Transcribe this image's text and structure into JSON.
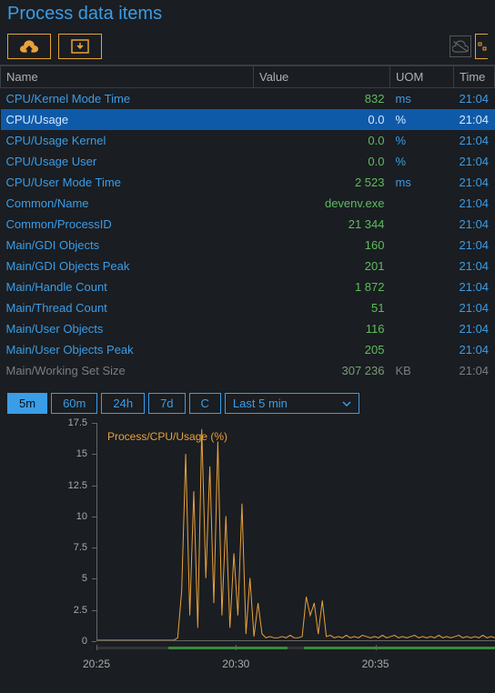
{
  "title": "Process data items",
  "columns": {
    "name": "Name",
    "value": "Value",
    "uom": "UOM",
    "time": "Time"
  },
  "rows": [
    {
      "name": "CPU/Kernel Mode Time",
      "value": "832",
      "uom": "ms",
      "time": "21:04",
      "sel": false
    },
    {
      "name": "CPU/Usage",
      "value": "0.0",
      "uom": "%",
      "time": "21:04",
      "sel": true
    },
    {
      "name": "CPU/Usage Kernel",
      "value": "0.0",
      "uom": "%",
      "time": "21:04",
      "sel": false
    },
    {
      "name": "CPU/Usage User",
      "value": "0.0",
      "uom": "%",
      "time": "21:04",
      "sel": false
    },
    {
      "name": "CPU/User Mode Time",
      "value": "2 523",
      "uom": "ms",
      "time": "21:04",
      "sel": false
    },
    {
      "name": "Common/Name",
      "value": "devenv.exe",
      "uom": "",
      "time": "21:04",
      "sel": false
    },
    {
      "name": "Common/ProcessID",
      "value": "21 344",
      "uom": "",
      "time": "21:04",
      "sel": false
    },
    {
      "name": "Main/GDI Objects",
      "value": "160",
      "uom": "",
      "time": "21:04",
      "sel": false
    },
    {
      "name": "Main/GDI Objects Peak",
      "value": "201",
      "uom": "",
      "time": "21:04",
      "sel": false
    },
    {
      "name": "Main/Handle Count",
      "value": "1 872",
      "uom": "",
      "time": "21:04",
      "sel": false
    },
    {
      "name": "Main/Thread Count",
      "value": "51",
      "uom": "",
      "time": "21:04",
      "sel": false
    },
    {
      "name": "Main/User Objects",
      "value": "116",
      "uom": "",
      "time": "21:04",
      "sel": false
    },
    {
      "name": "Main/User Objects Peak",
      "value": "205",
      "uom": "",
      "time": "21:04",
      "sel": false
    },
    {
      "name": "Main/Working Set Size",
      "value": "307 236",
      "uom": "KB",
      "time": "21:04",
      "sel": false,
      "dim": true
    }
  ],
  "ranges": {
    "r5m": "5m",
    "r60m": "60m",
    "r24h": "24h",
    "r7d": "7d",
    "rC": "C",
    "select": "Last 5 min"
  },
  "chart_data": {
    "type": "line",
    "title": "Process/CPU/Usage (%)",
    "xlabel": "",
    "ylabel": "",
    "ylim": [
      0,
      17.5
    ],
    "y_ticks": [
      0,
      2.5,
      5,
      7.5,
      10,
      12.5,
      15,
      17.5
    ],
    "x_ticks": [
      "20:25",
      "20:30",
      "20:35"
    ],
    "series": [
      {
        "name": "CPU Usage",
        "color": "#e8a23a",
        "x": [
          0,
          1,
          2,
          3,
          4,
          5,
          6,
          7,
          8,
          9,
          10,
          11,
          12,
          13,
          14,
          15,
          16,
          17,
          18,
          19,
          20,
          21,
          22,
          23,
          24,
          25,
          26,
          27,
          28,
          29,
          30,
          31,
          32,
          33,
          34,
          35,
          36,
          37,
          38,
          39,
          40,
          41,
          42,
          43,
          44,
          45,
          46,
          47,
          48,
          49,
          50,
          51,
          52,
          53,
          54,
          55,
          56,
          57,
          58,
          59,
          60,
          61,
          62,
          63,
          64,
          65,
          66,
          67,
          68,
          69,
          70,
          71,
          72,
          73,
          74,
          75,
          76,
          77,
          78,
          79,
          80,
          81,
          82,
          83,
          84,
          85,
          86,
          87,
          88,
          89,
          90,
          91,
          92,
          93,
          94,
          95,
          96,
          97,
          98,
          99
        ],
        "values": [
          0,
          0,
          0,
          0,
          0,
          0,
          0,
          0,
          0,
          0,
          0,
          0,
          0,
          0,
          0,
          0,
          0,
          0,
          0,
          0,
          0.2,
          4,
          15,
          2,
          12,
          1,
          17,
          5,
          14,
          3,
          16,
          2,
          10,
          1,
          7,
          2,
          11,
          0.5,
          5,
          0.3,
          3,
          0.5,
          0.2,
          0.3,
          0.2,
          0.2,
          0.3,
          0.2,
          0.4,
          0.2,
          0.2,
          0.3,
          3.5,
          2,
          3,
          0.5,
          3.2,
          0.3,
          0.4,
          0.2,
          0.3,
          0.2,
          0.4,
          0.2,
          0.3,
          0.2,
          0.4,
          0.3,
          0.2,
          0.3,
          0.2,
          0.4,
          0.2,
          0.3,
          0.4,
          0.2,
          0.3,
          0.2,
          0.3,
          0.4,
          0.2,
          0.3,
          0.2,
          0.3,
          0.2,
          0.4,
          0.2,
          0.3,
          0.2,
          0.3,
          0.4,
          0.2,
          0.3,
          0.2,
          0.3,
          0.2,
          0.4,
          0.2,
          0.3,
          0.2
        ]
      }
    ]
  }
}
